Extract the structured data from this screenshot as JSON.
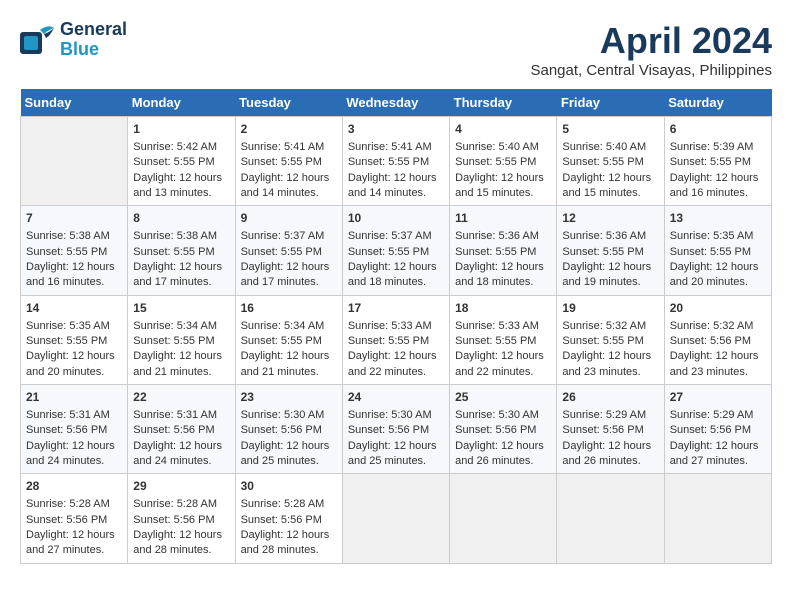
{
  "header": {
    "logo_line1": "General",
    "logo_line2": "Blue",
    "title": "April 2024",
    "location": "Sangat, Central Visayas, Philippines"
  },
  "columns": [
    "Sunday",
    "Monday",
    "Tuesday",
    "Wednesday",
    "Thursday",
    "Friday",
    "Saturday"
  ],
  "weeks": [
    [
      {
        "day": "",
        "empty": true
      },
      {
        "day": "1",
        "sunrise": "5:42 AM",
        "sunset": "5:55 PM",
        "daylight": "12 hours and 13 minutes."
      },
      {
        "day": "2",
        "sunrise": "5:41 AM",
        "sunset": "5:55 PM",
        "daylight": "12 hours and 14 minutes."
      },
      {
        "day": "3",
        "sunrise": "5:41 AM",
        "sunset": "5:55 PM",
        "daylight": "12 hours and 14 minutes."
      },
      {
        "day": "4",
        "sunrise": "5:40 AM",
        "sunset": "5:55 PM",
        "daylight": "12 hours and 15 minutes."
      },
      {
        "day": "5",
        "sunrise": "5:40 AM",
        "sunset": "5:55 PM",
        "daylight": "12 hours and 15 minutes."
      },
      {
        "day": "6",
        "sunrise": "5:39 AM",
        "sunset": "5:55 PM",
        "daylight": "12 hours and 16 minutes."
      }
    ],
    [
      {
        "day": "7",
        "sunrise": "5:38 AM",
        "sunset": "5:55 PM",
        "daylight": "12 hours and 16 minutes."
      },
      {
        "day": "8",
        "sunrise": "5:38 AM",
        "sunset": "5:55 PM",
        "daylight": "12 hours and 17 minutes."
      },
      {
        "day": "9",
        "sunrise": "5:37 AM",
        "sunset": "5:55 PM",
        "daylight": "12 hours and 17 minutes."
      },
      {
        "day": "10",
        "sunrise": "5:37 AM",
        "sunset": "5:55 PM",
        "daylight": "12 hours and 18 minutes."
      },
      {
        "day": "11",
        "sunrise": "5:36 AM",
        "sunset": "5:55 PM",
        "daylight": "12 hours and 18 minutes."
      },
      {
        "day": "12",
        "sunrise": "5:36 AM",
        "sunset": "5:55 PM",
        "daylight": "12 hours and 19 minutes."
      },
      {
        "day": "13",
        "sunrise": "5:35 AM",
        "sunset": "5:55 PM",
        "daylight": "12 hours and 20 minutes."
      }
    ],
    [
      {
        "day": "14",
        "sunrise": "5:35 AM",
        "sunset": "5:55 PM",
        "daylight": "12 hours and 20 minutes."
      },
      {
        "day": "15",
        "sunrise": "5:34 AM",
        "sunset": "5:55 PM",
        "daylight": "12 hours and 21 minutes."
      },
      {
        "day": "16",
        "sunrise": "5:34 AM",
        "sunset": "5:55 PM",
        "daylight": "12 hours and 21 minutes."
      },
      {
        "day": "17",
        "sunrise": "5:33 AM",
        "sunset": "5:55 PM",
        "daylight": "12 hours and 22 minutes."
      },
      {
        "day": "18",
        "sunrise": "5:33 AM",
        "sunset": "5:55 PM",
        "daylight": "12 hours and 22 minutes."
      },
      {
        "day": "19",
        "sunrise": "5:32 AM",
        "sunset": "5:55 PM",
        "daylight": "12 hours and 23 minutes."
      },
      {
        "day": "20",
        "sunrise": "5:32 AM",
        "sunset": "5:56 PM",
        "daylight": "12 hours and 23 minutes."
      }
    ],
    [
      {
        "day": "21",
        "sunrise": "5:31 AM",
        "sunset": "5:56 PM",
        "daylight": "12 hours and 24 minutes."
      },
      {
        "day": "22",
        "sunrise": "5:31 AM",
        "sunset": "5:56 PM",
        "daylight": "12 hours and 24 minutes."
      },
      {
        "day": "23",
        "sunrise": "5:30 AM",
        "sunset": "5:56 PM",
        "daylight": "12 hours and 25 minutes."
      },
      {
        "day": "24",
        "sunrise": "5:30 AM",
        "sunset": "5:56 PM",
        "daylight": "12 hours and 25 minutes."
      },
      {
        "day": "25",
        "sunrise": "5:30 AM",
        "sunset": "5:56 PM",
        "daylight": "12 hours and 26 minutes."
      },
      {
        "day": "26",
        "sunrise": "5:29 AM",
        "sunset": "5:56 PM",
        "daylight": "12 hours and 26 minutes."
      },
      {
        "day": "27",
        "sunrise": "5:29 AM",
        "sunset": "5:56 PM",
        "daylight": "12 hours and 27 minutes."
      }
    ],
    [
      {
        "day": "28",
        "sunrise": "5:28 AM",
        "sunset": "5:56 PM",
        "daylight": "12 hours and 27 minutes."
      },
      {
        "day": "29",
        "sunrise": "5:28 AM",
        "sunset": "5:56 PM",
        "daylight": "12 hours and 28 minutes."
      },
      {
        "day": "30",
        "sunrise": "5:28 AM",
        "sunset": "5:56 PM",
        "daylight": "12 hours and 28 minutes."
      },
      {
        "day": "",
        "empty": true
      },
      {
        "day": "",
        "empty": true
      },
      {
        "day": "",
        "empty": true
      },
      {
        "day": "",
        "empty": true
      }
    ]
  ]
}
